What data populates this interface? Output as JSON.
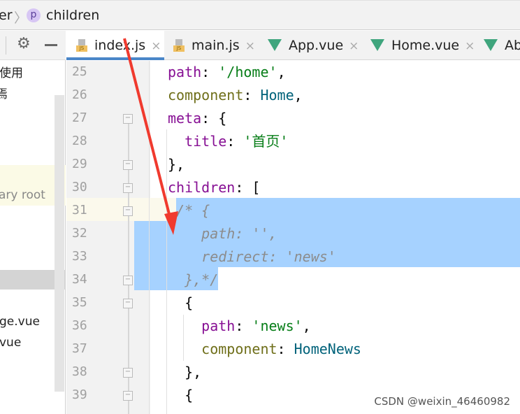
{
  "breadcrumb": {
    "prev": "er",
    "separator": "〉",
    "badge": "p",
    "current": "children"
  },
  "left_panel": {
    "items": [
      "使用",
      "焉",
      "ary root",
      "ge.vue",
      "vue"
    ]
  },
  "tabs": [
    {
      "label": "index.js",
      "icon": "js-file-icon",
      "active": true
    },
    {
      "label": "main.js",
      "icon": "js-file-icon"
    },
    {
      "label": "App.vue",
      "icon": "vue-icon"
    },
    {
      "label": "Home.vue",
      "icon": "vue-icon"
    },
    {
      "label": "Ab",
      "icon": "vue-icon"
    }
  ],
  "close_glyph": "×",
  "editor": {
    "lines": [
      {
        "n": "25",
        "tokens": [
          {
            "t": "path",
            "k": "key"
          },
          {
            "t": ": ",
            "k": "pun"
          },
          {
            "t": "'/home'",
            "k": "str"
          },
          {
            "t": ",",
            "k": "pun"
          }
        ]
      },
      {
        "n": "26",
        "tokens": [
          {
            "t": "component",
            "k": "prop"
          },
          {
            "t": ": ",
            "k": "pun"
          },
          {
            "t": "Home",
            "k": "id"
          },
          {
            "t": ",",
            "k": "pun"
          }
        ]
      },
      {
        "n": "27",
        "tokens": [
          {
            "t": "meta",
            "k": "key"
          },
          {
            "t": ": {",
            "k": "pun"
          }
        ]
      },
      {
        "n": "28",
        "tokens": [
          {
            "t": "  title",
            "k": "key"
          },
          {
            "t": ": ",
            "k": "pun"
          },
          {
            "t": "'首页'",
            "k": "str"
          }
        ]
      },
      {
        "n": "29",
        "tokens": [
          {
            "t": "},",
            "k": "pun"
          }
        ]
      },
      {
        "n": "30",
        "tokens": [
          {
            "t": "children",
            "k": "key"
          },
          {
            "t": ": [",
            "k": "pun"
          }
        ]
      },
      {
        "n": "31",
        "tokens": [
          {
            "t": " /* {",
            "k": "cm"
          }
        ]
      },
      {
        "n": "32",
        "tokens": [
          {
            "t": "    path: '',",
            "k": "cm"
          }
        ]
      },
      {
        "n": "33",
        "tokens": [
          {
            "t": "    redirect: 'news'",
            "k": "cm"
          }
        ]
      },
      {
        "n": "34",
        "tokens": [
          {
            "t": "  },*/",
            "k": "cm"
          }
        ]
      },
      {
        "n": "35",
        "tokens": [
          {
            "t": "  {",
            "k": "pun"
          }
        ]
      },
      {
        "n": "36",
        "tokens": [
          {
            "t": "    path",
            "k": "key"
          },
          {
            "t": ": ",
            "k": "pun"
          },
          {
            "t": "'news'",
            "k": "str"
          },
          {
            "t": ",",
            "k": "pun"
          }
        ]
      },
      {
        "n": "37",
        "tokens": [
          {
            "t": "    component",
            "k": "prop"
          },
          {
            "t": ": ",
            "k": "pun"
          },
          {
            "t": "HomeNews",
            "k": "id"
          }
        ]
      },
      {
        "n": "38",
        "tokens": [
          {
            "t": "  },",
            "k": "pun"
          }
        ]
      },
      {
        "n": "39",
        "tokens": [
          {
            "t": "  {",
            "k": "pun"
          }
        ]
      }
    ]
  },
  "watermark": "CSDN @weixin_46460982"
}
